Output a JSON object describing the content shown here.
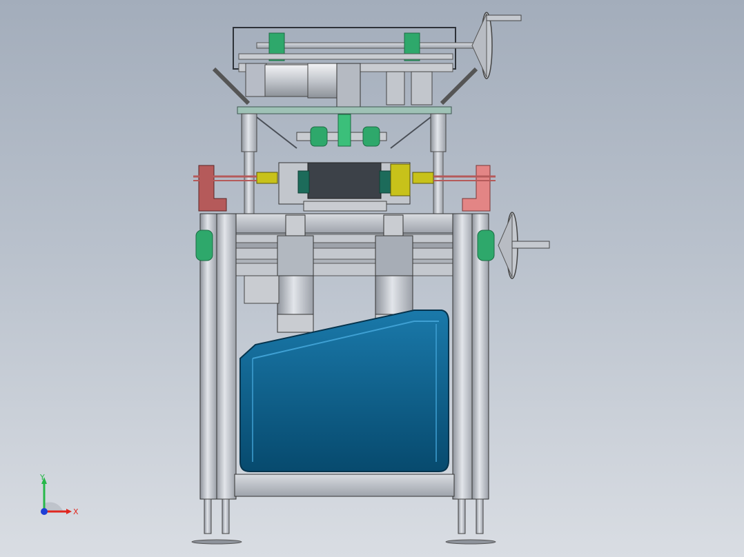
{
  "viewport": {
    "background_top": "#a3adbb",
    "background_bottom": "#d9dde3"
  },
  "model": {
    "frame_color": "#b7bcc6",
    "frame_edge_color": "#4a4f57",
    "hopper_color": "#0b5a84",
    "hopper_highlight": "#2f8fc0",
    "accent_green": "#2ea86b",
    "accent_yellow": "#c8c21a",
    "accent_red": "#b55a5a",
    "accent_pink": "#e38585",
    "motor_color": "#c9ccd1"
  },
  "triad": {
    "x_label": "X",
    "y_label": "Y",
    "x_color": "#e0271f",
    "y_color": "#27b84a",
    "z_color": "#1f3fd6"
  }
}
